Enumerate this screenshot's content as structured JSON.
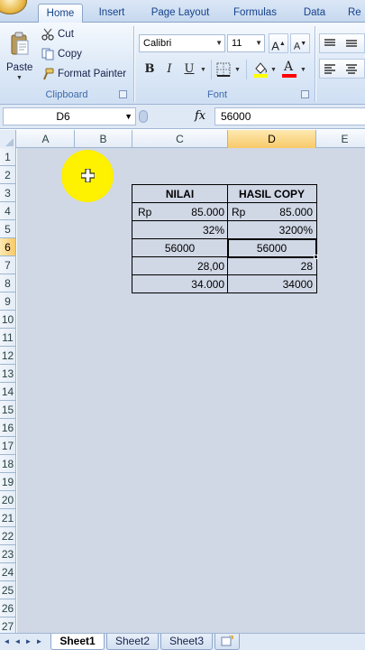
{
  "ribbon": {
    "tabs": [
      {
        "label": "Home",
        "active": true
      },
      {
        "label": "Insert"
      },
      {
        "label": "Page Layout"
      },
      {
        "label": "Formulas"
      },
      {
        "label": "Data"
      },
      {
        "label": "Re"
      }
    ],
    "clipboard": {
      "group_label": "Clipboard",
      "paste_label": "Paste",
      "cut_label": "Cut",
      "copy_label": "Copy",
      "format_painter_label": "Format Painter"
    },
    "font": {
      "group_label": "Font",
      "font_name": "Calibri",
      "font_size": "11",
      "bold": "B",
      "italic": "I",
      "underline": "U",
      "grow": "A",
      "shrink": "A",
      "font_color_swatch": "#ff0000",
      "fill_color_swatch": "#ffff00"
    }
  },
  "formula_bar": {
    "name_box": "D6",
    "fx": "fx",
    "value": "56000"
  },
  "grid": {
    "columns": [
      "A",
      "B",
      "C",
      "D",
      "E"
    ],
    "rows": [
      "1",
      "2",
      "3",
      "4",
      "5",
      "6",
      "7",
      "8",
      "9",
      "10",
      "11",
      "12",
      "13",
      "14",
      "15",
      "16",
      "17",
      "18",
      "19",
      "20",
      "21",
      "22",
      "23",
      "24",
      "25",
      "26",
      "27"
    ],
    "selected_column": "D",
    "selected_row": "6",
    "active_cell": "D6",
    "table": {
      "header_c": "NILAI",
      "header_d": "HASIL COPY",
      "rows": [
        {
          "c_prefix": "Rp",
          "c": "85.000",
          "d_prefix": "Rp",
          "d": "85.000"
        },
        {
          "c": "32%",
          "d": "3200%"
        },
        {
          "c": "56000",
          "d": "56000"
        },
        {
          "c": "28,00",
          "d": "28"
        },
        {
          "c": "34.000",
          "d": "34000"
        }
      ]
    }
  },
  "sheets": {
    "tabs": [
      "Sheet1",
      "Sheet2",
      "Sheet3"
    ],
    "active": "Sheet1"
  },
  "colors": {
    "selection_header": "#f8c969",
    "cursor_highlight": "#fff200",
    "ribbon_text": "#15428b"
  },
  "icons": [
    "cut-icon",
    "copy-icon",
    "format-painter-icon",
    "paste-icon",
    "insert-sheet-icon",
    "cursor-move-icon"
  ]
}
